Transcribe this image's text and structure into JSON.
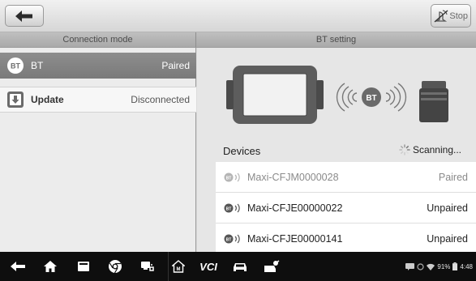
{
  "toolbar": {
    "stop_label": "Stop"
  },
  "columns": {
    "left_title": "Connection mode",
    "right_title": "BT setting"
  },
  "connection_modes": [
    {
      "label": "BT",
      "status": "Paired",
      "icon_text": "BT",
      "selected": true
    },
    {
      "label": "Update",
      "status": "Disconnected",
      "selected": false
    }
  ],
  "bt_setting": {
    "illustration_badge": "BT",
    "devices_label": "Devices",
    "scanning_label": "Scanning...",
    "devices": [
      {
        "name": "Maxi-CFJM0000028",
        "status": "Paired"
      },
      {
        "name": "Maxi-CFJE00000022",
        "status": "Unpaired"
      },
      {
        "name": "Maxi-CFJE00000141",
        "status": "Unpaired"
      }
    ]
  },
  "navbar": {
    "vci_label": "VCI",
    "status": {
      "battery_percent": "91%",
      "time": "4:48"
    }
  }
}
